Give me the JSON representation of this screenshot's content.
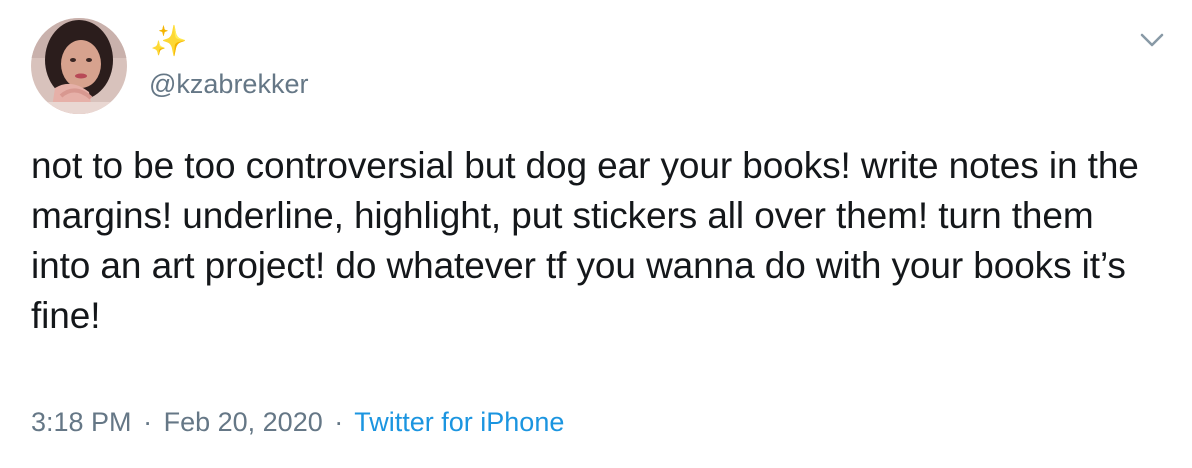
{
  "user": {
    "display_name": "✨",
    "handle": "@kzabrekker"
  },
  "tweet": {
    "text": "not to be too controversial but dog ear your books! write notes in the margins! underline, highlight, put stickers all over them! turn them into an art project! do whatever tf you wanna do with your books it’s fine!"
  },
  "meta": {
    "time": "3:18 PM",
    "separator_1": "·",
    "date": "Feb 20, 2020",
    "separator_2": "·",
    "source": "Twitter for iPhone"
  },
  "icons": {
    "menu": "chevron-down-icon"
  },
  "colors": {
    "text": "#14171a",
    "secondary": "#657786",
    "link": "#1b95e0",
    "sparkle": "#ffad1f"
  }
}
